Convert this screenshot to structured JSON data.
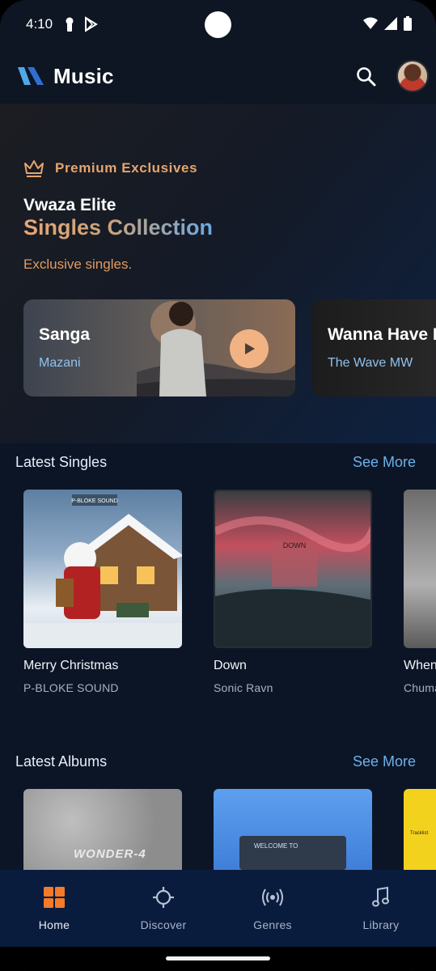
{
  "status_bar": {
    "time": "4:10"
  },
  "app_bar": {
    "title": "Music"
  },
  "hero": {
    "badge": "Premium Exclusives",
    "title_line1": "Vwaza Elite",
    "title_line2": "Singles Collection",
    "subtitle": "Exclusive singles.",
    "cards": [
      {
        "title": "Sanga",
        "artist": "Mazani"
      },
      {
        "title": "Wanna Have F",
        "artist": "The Wave MW"
      }
    ]
  },
  "latest_singles": {
    "title": "Latest Singles",
    "see_more": "See More",
    "items": [
      {
        "title": "Merry Christmas",
        "artist": "P-BLOKE SOUND",
        "art_text": "P-BLOKE SOUND"
      },
      {
        "title": "Down",
        "artist": "Sonic Ravn",
        "art_text": "DOWN"
      },
      {
        "title": "When",
        "artist": "Chuma"
      }
    ]
  },
  "latest_albums": {
    "title": "Latest Albums",
    "see_more": "See More",
    "items": [
      {
        "art_text": "WONDER-4"
      },
      {
        "art_text": "WELCOME TO"
      },
      {
        "art_text": "Tracklist"
      }
    ]
  },
  "bottom_nav": [
    {
      "label": "Home",
      "icon": "home-grid-icon",
      "active": true
    },
    {
      "label": "Discover",
      "icon": "crosshair-icon",
      "active": false
    },
    {
      "label": "Genres",
      "icon": "broadcast-icon",
      "active": false
    },
    {
      "label": "Library",
      "icon": "music-note-icon",
      "active": false
    }
  ],
  "colors": {
    "accent_orange": "#f37b2a",
    "link_blue": "#6db2ea",
    "premium_gold": "#e5a56f",
    "nav_bg": "#0a1c3e"
  }
}
